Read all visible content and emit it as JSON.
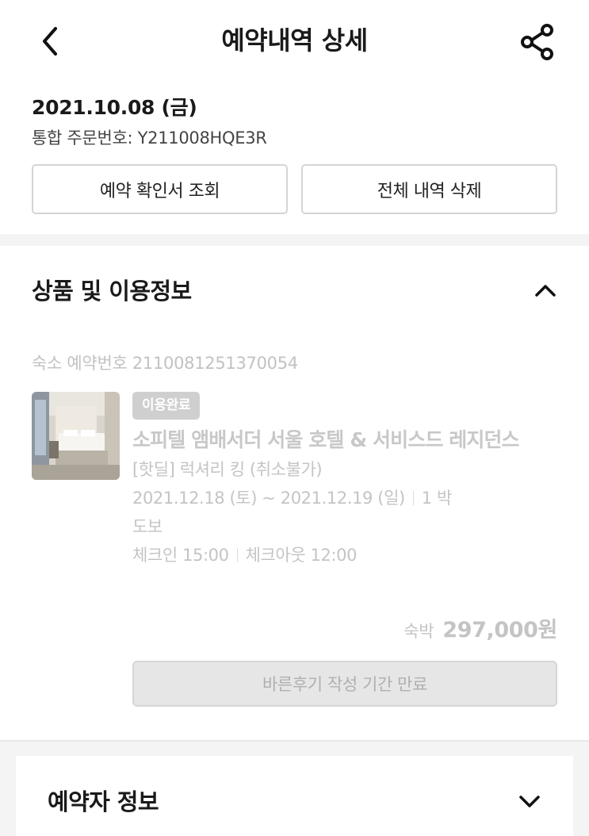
{
  "header": {
    "title": "예약내역 상세",
    "back_icon": "chevron-left-icon",
    "share_icon": "share-icon"
  },
  "order": {
    "date": "2021.10.08 (금)",
    "number_label": "통합 주문번호: ",
    "number_value": "Y211008HQE3R"
  },
  "actions": {
    "confirm_label": "예약 확인서 조회",
    "delete_label": "전체 내역 삭제"
  },
  "product_section": {
    "title": "상품 및 이용정보",
    "toggle_icon": "chevron-up-icon",
    "reservation_no_label": "숙소 예약번호 ",
    "reservation_no_value": "2110081251370054",
    "status_badge": "이용완료",
    "hotel_name": "소피텔 앰배서더 서울 호텔 & 서비스드 레지던스",
    "room_type": "[핫딜] 럭셔리 킹 (취소불가)",
    "stay_dates": "2021.12.18 (토) ~ 2021.12.19 (일)",
    "nights": "1 박",
    "transport": "도보",
    "checkin": "체크인 15:00",
    "checkout": "체크아웃 12:00",
    "price_label": "숙박",
    "price_value": "297,000원",
    "review_button": "바른후기 작성 기간 만료"
  },
  "booker_section": {
    "title": "예약자 정보",
    "toggle_icon": "chevron-down-icon"
  },
  "colors": {
    "primary_text": "#1a1a1a",
    "muted_text": "#c4c4c4",
    "badge_bg": "#cfcfcf",
    "divider": "#f4f4f4"
  }
}
